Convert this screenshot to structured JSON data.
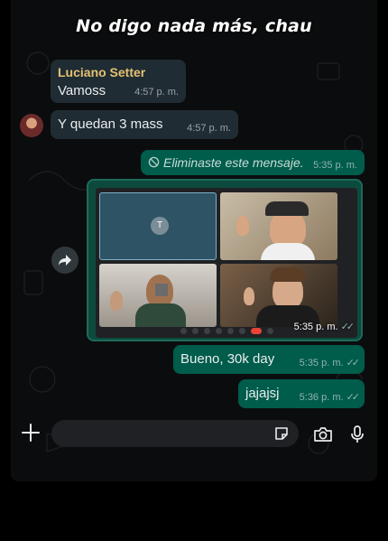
{
  "overlay": {
    "caption": "No digo nada más, chau"
  },
  "messages": {
    "m1": {
      "sender": "Luciano Setter",
      "text": "Vamoss",
      "time": "4:57 p. m."
    },
    "m2": {
      "text": "Y quedan 3 mass",
      "time": "4:57 p. m."
    },
    "m3": {
      "text": "Eliminaste este mensaje.",
      "time": "5:35 p. m."
    },
    "m4": {
      "tile_initial": "T",
      "time": "5:35 p. m."
    },
    "m5": {
      "text": "Bueno, 30k day",
      "time": "5:35 p. m."
    },
    "m6": {
      "text": "jajajsj",
      "time": "5:36 p. m."
    }
  },
  "colors": {
    "outgoing_bubble": "#005c4b",
    "incoming_bubble": "#202c33",
    "sender_name": "#e4c172",
    "background": "#0b0c0d"
  },
  "icons": [
    "forward-icon",
    "prohibited-icon",
    "double-check-icon",
    "plus-icon",
    "sticker-icon",
    "camera-icon",
    "microphone-icon"
  ]
}
